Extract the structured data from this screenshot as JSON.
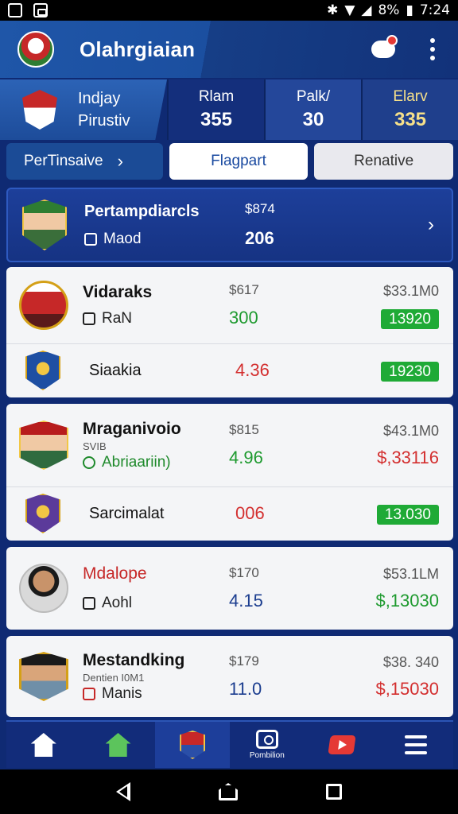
{
  "status_bar": {
    "battery": "8%",
    "time": "7:24"
  },
  "app": {
    "title": "Olahrgiaian"
  },
  "summary": {
    "line1": "Indjay",
    "line2": "Pirustiv",
    "cols": [
      {
        "label": "Rlam",
        "value": "355"
      },
      {
        "label": "Palk/",
        "value": "30"
      },
      {
        "label": "Elarv",
        "value": "335"
      }
    ]
  },
  "tabs": [
    {
      "label": "PerTinsaive",
      "chevron": "›"
    },
    {
      "label": "Flagpart"
    },
    {
      "label": "Renative"
    }
  ],
  "featured": {
    "name": "Pertampdiarcls",
    "sub": "Maod",
    "price": "$874",
    "value": "206",
    "chevron": "›"
  },
  "cards": [
    {
      "rows": [
        {
          "name": "Vidaraks",
          "meta": "RaN",
          "price": "$617",
          "value": "300",
          "right_price": "$33.1M0",
          "right_value": "13920"
        },
        {
          "name": "Siaakia",
          "price": "",
          "value": "4.36",
          "right_price": "",
          "right_value": "19230"
        }
      ]
    },
    {
      "rows": [
        {
          "name": "Mraganivoio",
          "tiny": "SVIB",
          "meta": "Abriaariin)",
          "price": "$815",
          "value": "4.96",
          "right_price": "$43.1M0",
          "right_value": "$,33116"
        },
        {
          "name": "Sarcimalat",
          "price": "",
          "value": "006",
          "right_price": "",
          "right_value": "13.030"
        }
      ]
    },
    {
      "rows": [
        {
          "name": "Mdalope",
          "meta": "Aohl",
          "price": "$170",
          "value": "4.15",
          "right_price": "$53.1LM",
          "right_value": "$,13030"
        }
      ]
    },
    {
      "rows": [
        {
          "name": "Mestandking",
          "tiny": "Dentien I0M1",
          "meta": "Manis",
          "price": "$179",
          "value": "11.0",
          "right_price": "$38. 340",
          "right_value": "$,15030"
        }
      ]
    }
  ],
  "bottom_nav": {
    "camera_label": "Pombilion"
  },
  "colors": {
    "brand_blue": "#12327a",
    "positive": "#1e9a2f",
    "negative": "#d32f2f"
  }
}
